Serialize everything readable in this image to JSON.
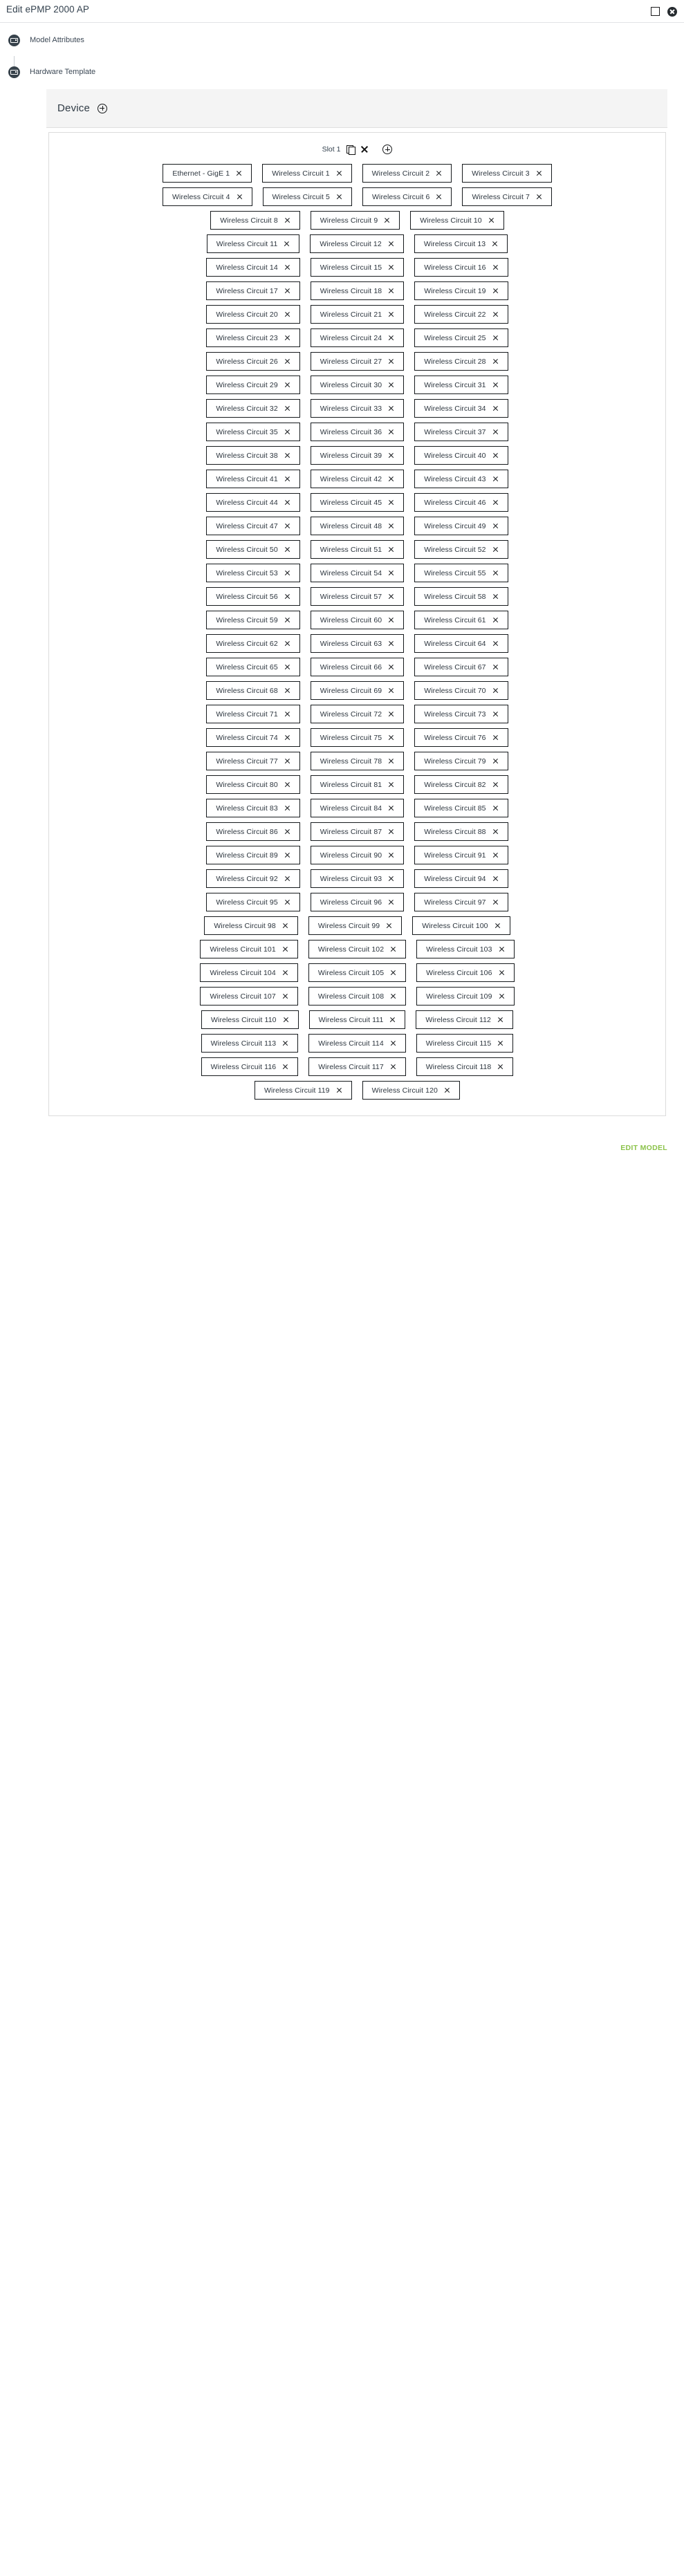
{
  "window": {
    "title": "Edit ePMP 2000 AP",
    "maximize_label": "Maximize",
    "close_label": "Close"
  },
  "nav": {
    "items": [
      {
        "label": "Model Attributes",
        "icon": "device-screen-icon"
      },
      {
        "label": "Hardware Template",
        "icon": "device-screen-icon"
      }
    ]
  },
  "device": {
    "title": "Device",
    "add_label": "Add device"
  },
  "slot": {
    "label": "Slot 1",
    "copy_label": "Copy slot",
    "remove_label": "Remove slot",
    "add_label": "Add port"
  },
  "footer": {
    "edit_model_label": "EDIT MODEL",
    "accent_color": "#8cc34b"
  },
  "colors": {
    "header_bg": "#f4f4f4",
    "border": "#dcdcdc",
    "chip_border": "#15191c",
    "text": "#2f3a44",
    "nav_icon_bg": "#37424b"
  },
  "chip_rows": [
    [
      "Ethernet - GigE 1",
      "Wireless Circuit 1",
      "Wireless Circuit 2",
      "Wireless Circuit 3"
    ],
    [
      "Wireless Circuit 4",
      "Wireless Circuit 5",
      "Wireless Circuit 6",
      "Wireless Circuit 7"
    ],
    [
      "Wireless Circuit 8",
      "Wireless Circuit 9",
      "Wireless Circuit 10"
    ],
    [
      "Wireless Circuit 11",
      "Wireless Circuit 12",
      "Wireless Circuit 13"
    ],
    [
      "Wireless Circuit 14",
      "Wireless Circuit 15",
      "Wireless Circuit 16"
    ],
    [
      "Wireless Circuit 17",
      "Wireless Circuit 18",
      "Wireless Circuit 19"
    ],
    [
      "Wireless Circuit 20",
      "Wireless Circuit 21",
      "Wireless Circuit 22"
    ],
    [
      "Wireless Circuit 23",
      "Wireless Circuit 24",
      "Wireless Circuit 25"
    ],
    [
      "Wireless Circuit 26",
      "Wireless Circuit 27",
      "Wireless Circuit 28"
    ],
    [
      "Wireless Circuit 29",
      "Wireless Circuit 30",
      "Wireless Circuit 31"
    ],
    [
      "Wireless Circuit 32",
      "Wireless Circuit 33",
      "Wireless Circuit 34"
    ],
    [
      "Wireless Circuit 35",
      "Wireless Circuit 36",
      "Wireless Circuit 37"
    ],
    [
      "Wireless Circuit 38",
      "Wireless Circuit 39",
      "Wireless Circuit 40"
    ],
    [
      "Wireless Circuit 41",
      "Wireless Circuit 42",
      "Wireless Circuit 43"
    ],
    [
      "Wireless Circuit 44",
      "Wireless Circuit 45",
      "Wireless Circuit 46"
    ],
    [
      "Wireless Circuit 47",
      "Wireless Circuit 48",
      "Wireless Circuit 49"
    ],
    [
      "Wireless Circuit 50",
      "Wireless Circuit 51",
      "Wireless Circuit 52"
    ],
    [
      "Wireless Circuit 53",
      "Wireless Circuit 54",
      "Wireless Circuit 55"
    ],
    [
      "Wireless Circuit 56",
      "Wireless Circuit 57",
      "Wireless Circuit 58"
    ],
    [
      "Wireless Circuit 59",
      "Wireless Circuit 60",
      "Wireless Circuit 61"
    ],
    [
      "Wireless Circuit 62",
      "Wireless Circuit 63",
      "Wireless Circuit 64"
    ],
    [
      "Wireless Circuit 65",
      "Wireless Circuit 66",
      "Wireless Circuit 67"
    ],
    [
      "Wireless Circuit 68",
      "Wireless Circuit 69",
      "Wireless Circuit 70"
    ],
    [
      "Wireless Circuit 71",
      "Wireless Circuit 72",
      "Wireless Circuit 73"
    ],
    [
      "Wireless Circuit 74",
      "Wireless Circuit 75",
      "Wireless Circuit 76"
    ],
    [
      "Wireless Circuit 77",
      "Wireless Circuit 78",
      "Wireless Circuit 79"
    ],
    [
      "Wireless Circuit 80",
      "Wireless Circuit 81",
      "Wireless Circuit 82"
    ],
    [
      "Wireless Circuit 83",
      "Wireless Circuit 84",
      "Wireless Circuit 85"
    ],
    [
      "Wireless Circuit 86",
      "Wireless Circuit 87",
      "Wireless Circuit 88"
    ],
    [
      "Wireless Circuit 89",
      "Wireless Circuit 90",
      "Wireless Circuit 91"
    ],
    [
      "Wireless Circuit 92",
      "Wireless Circuit 93",
      "Wireless Circuit 94"
    ],
    [
      "Wireless Circuit 95",
      "Wireless Circuit 96",
      "Wireless Circuit 97"
    ],
    [
      "Wireless Circuit 98",
      "Wireless Circuit 99",
      "Wireless Circuit 100"
    ],
    [
      "Wireless Circuit 101",
      "Wireless Circuit 102",
      "Wireless Circuit 103"
    ],
    [
      "Wireless Circuit 104",
      "Wireless Circuit 105",
      "Wireless Circuit 106"
    ],
    [
      "Wireless Circuit 107",
      "Wireless Circuit 108",
      "Wireless Circuit 109"
    ],
    [
      "Wireless Circuit 110",
      "Wireless Circuit 111",
      "Wireless Circuit 112"
    ],
    [
      "Wireless Circuit 113",
      "Wireless Circuit 114",
      "Wireless Circuit 115"
    ],
    [
      "Wireless Circuit 116",
      "Wireless Circuit 117",
      "Wireless Circuit 118"
    ],
    [
      "Wireless Circuit 119",
      "Wireless Circuit 120"
    ]
  ]
}
